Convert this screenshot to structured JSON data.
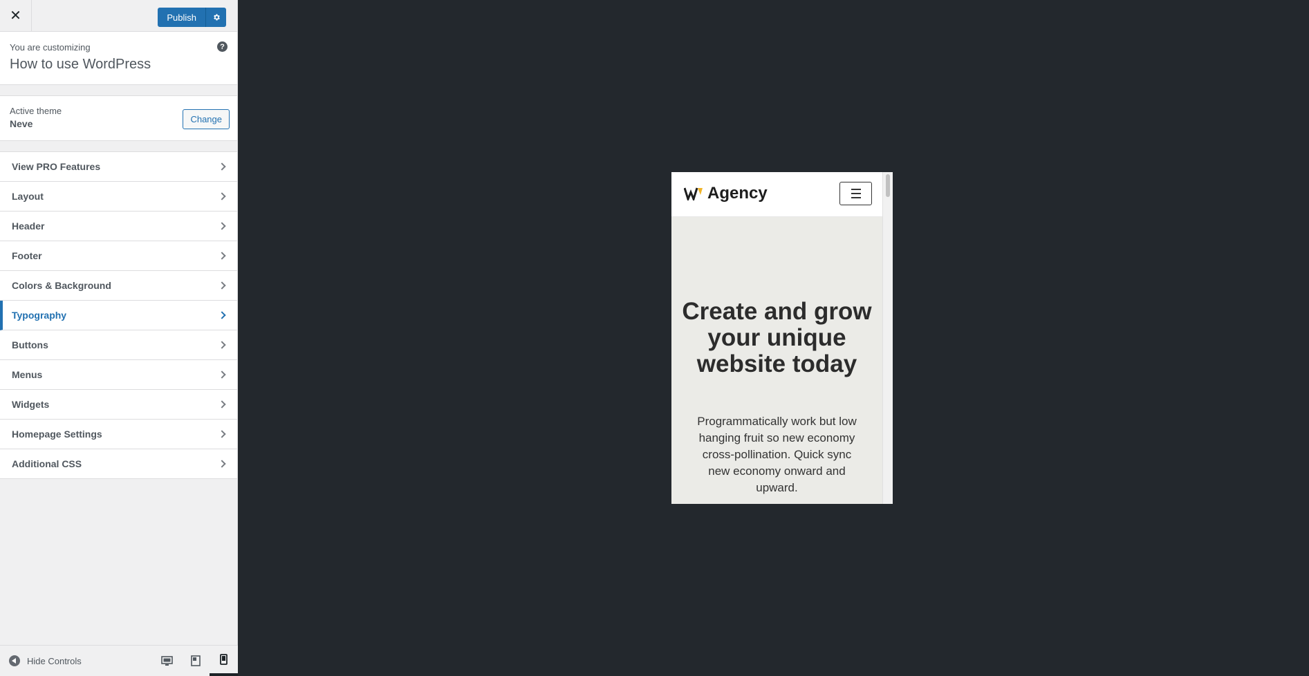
{
  "topbar": {
    "close_label": "✕",
    "publish_label": "Publish",
    "settings_icon": "gear-icon"
  },
  "info": {
    "subtitle": "You are customizing",
    "site_title": "How to use WordPress",
    "help_label": "?"
  },
  "theme": {
    "label": "Active theme",
    "name": "Neve",
    "change_label": "Change"
  },
  "menu": {
    "items": [
      {
        "label": "View PRO Features"
      },
      {
        "label": "Layout"
      },
      {
        "label": "Header"
      },
      {
        "label": "Footer"
      },
      {
        "label": "Colors & Background"
      },
      {
        "label": "Typography",
        "active": true
      },
      {
        "label": "Buttons"
      },
      {
        "label": "Menus"
      },
      {
        "label": "Widgets"
      },
      {
        "label": "Homepage Settings"
      },
      {
        "label": "Additional CSS"
      }
    ]
  },
  "footer": {
    "hide_controls_label": "Hide Controls",
    "devices": [
      "desktop",
      "tablet",
      "mobile"
    ],
    "active_device": "mobile"
  },
  "preview": {
    "logo_text": "Agency",
    "hero_title": "Create and grow your unique website today",
    "hero_text": "Programmatically work but low hanging fruit so new economy cross-pollination. Quick sync new economy onward and upward."
  },
  "colors": {
    "accent": "#2271b1",
    "canvas": "#23282d",
    "hero_bg": "#ebebe7",
    "logo_accent": "#f0b429"
  }
}
